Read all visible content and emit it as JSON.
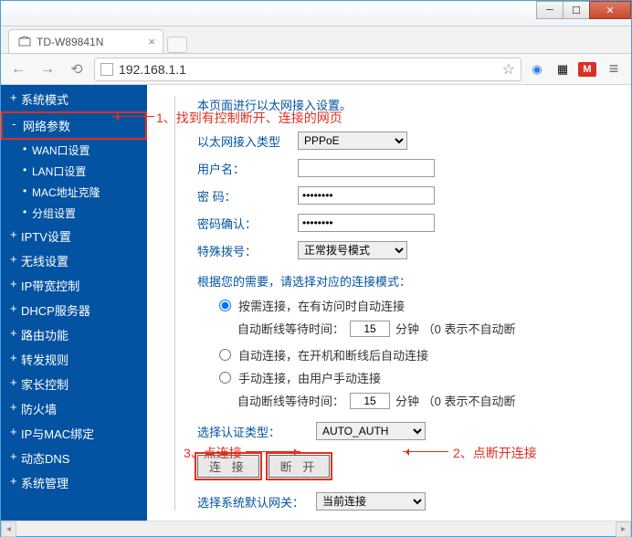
{
  "window": {
    "title": "TD-W89841N"
  },
  "address": {
    "url": "192.168.1.1"
  },
  "sidebar": {
    "items": [
      {
        "label": "系统模式",
        "level": 1
      },
      {
        "label": "网络参数",
        "level": 1,
        "expanded": true
      },
      {
        "label": "WAN口设置",
        "level": 2
      },
      {
        "label": "LAN口设置",
        "level": 2
      },
      {
        "label": "MAC地址克隆",
        "level": 2
      },
      {
        "label": "分组设置",
        "level": 2
      },
      {
        "label": "IPTV设置",
        "level": 1
      },
      {
        "label": "无线设置",
        "level": 1
      },
      {
        "label": "IP带宽控制",
        "level": 1
      },
      {
        "label": "DHCP服务器",
        "level": 1
      },
      {
        "label": "路由功能",
        "level": 1
      },
      {
        "label": "转发规则",
        "level": 1
      },
      {
        "label": "家长控制",
        "level": 1
      },
      {
        "label": "防火墙",
        "level": 1
      },
      {
        "label": "IP与MAC绑定",
        "level": 1
      },
      {
        "label": "动态DNS",
        "level": 1
      },
      {
        "label": "系统管理",
        "level": 1
      }
    ]
  },
  "main": {
    "intro": "本页面进行以太网接入设置。",
    "eth_type_label": "以太网接入类型",
    "eth_type_value": "PPPoE",
    "username_label": "用户名：",
    "username_value": "",
    "password_label": "密 码：",
    "password_value": "••••••••",
    "password_confirm_label": "密码确认：",
    "password_confirm_value": "••••••••",
    "special_dial_label": "特殊拨号：",
    "special_dial_value": "正常拨号模式",
    "mode_note": "根据您的需要，请选择对应的连接模式：",
    "mode_options": [
      "按需连接，在有访问时自动连接",
      "自动连接，在开机和断线后自动连接",
      "手动连接，由用户手动连接"
    ],
    "idle_label": "自动断线等待时间：",
    "idle_value": "15",
    "idle_unit": "分钟 （0 表示不自动断",
    "auth_label": "选择认证类型：",
    "auth_value": "AUTO_AUTH",
    "btn_connect": "连 接",
    "btn_disconnect": "断 开",
    "gateway_label": "选择系统默认网关：",
    "gateway_value": "当前连接"
  },
  "annotations": {
    "a1": "1、找到有控制断开、连接的网页",
    "a2": "2、点断开连接",
    "a3": "3、点连接"
  }
}
